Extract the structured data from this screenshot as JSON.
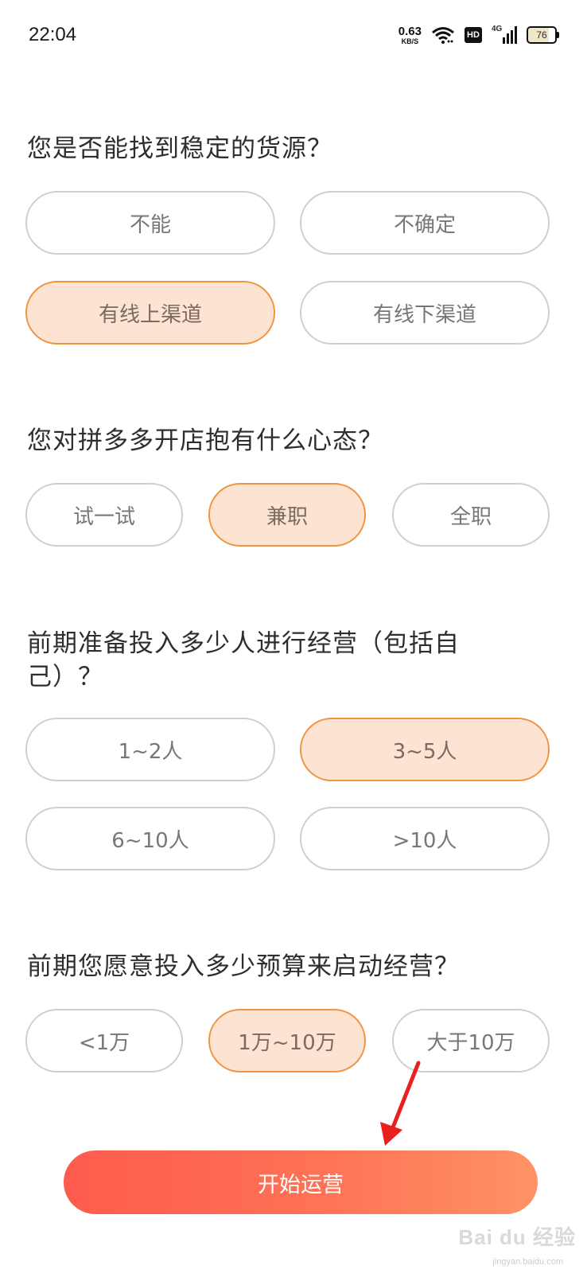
{
  "status_bar": {
    "time": "22:04",
    "net_speed_value": "0.63",
    "net_speed_unit": "KB/S",
    "hd_label": "HD",
    "network_label": "4G",
    "battery": "76"
  },
  "questions": [
    {
      "text": "您是否能找到稳定的货源？",
      "options": [
        "不能",
        "不确定",
        "有线上渠道",
        "有线下渠道"
      ],
      "selected": "有线上渠道"
    },
    {
      "text": "您对拼多多开店抱有什么心态？",
      "options": [
        "试一试",
        "兼职",
        "全职"
      ],
      "selected": "兼职"
    },
    {
      "text": "前期准备投入多少人进行经营（包括自己）？",
      "options": [
        "1~2人",
        "3~5人",
        "6~10人",
        ">10人"
      ],
      "selected": "3~5人"
    },
    {
      "text": "前期您愿意投入多少预算来启动经营？",
      "options": [
        "<1万",
        "1万~10万",
        "大于10万"
      ],
      "selected": "1万~10万"
    }
  ],
  "start_button": "开始运营",
  "watermark": {
    "brand": "Bai du 经验",
    "url": "jingyan.baidu.com"
  },
  "colors": {
    "selected_border": "#ef9442",
    "selected_fill": "#fde3d2",
    "button_gradient_start": "#fd5b4d",
    "button_gradient_end": "#fe9364",
    "annotation_arrow": "#e8201e"
  }
}
